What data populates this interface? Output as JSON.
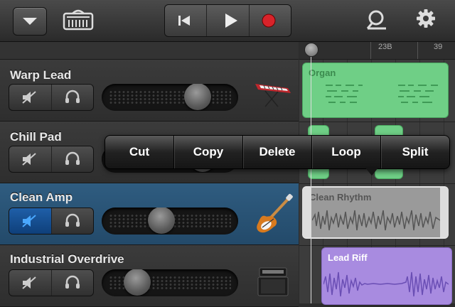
{
  "toolbar": {
    "icons": [
      "chevron-down-icon",
      "amp-icon",
      "rewind-icon",
      "play-icon",
      "record-icon",
      "loop-settings-icon",
      "gear-icon"
    ],
    "colors": {
      "record": "#d8232a"
    }
  },
  "tracks": [
    {
      "name": "Warp Lead",
      "instrument": "keyboard-synth-icon",
      "volume": 0.75,
      "muted": false
    },
    {
      "name": "Chill Pad",
      "instrument": "",
      "volume": 0.8,
      "muted": false
    },
    {
      "name": "Clean Amp",
      "instrument": "electric-guitar-icon",
      "volume": 0.42,
      "muted": true,
      "selected": true
    },
    {
      "name": "Industrial Overdrive",
      "instrument": "amplifier-stack-icon",
      "volume": 0.2,
      "muted": false
    }
  ],
  "ruler": {
    "labels": [
      "23B",
      "39"
    ]
  },
  "regions": {
    "organ": {
      "label": "Organ",
      "color": "#6fcf86"
    },
    "clean_rhythm": {
      "label": "Clean Rhythm",
      "color": "#9a9a9a"
    },
    "lead_riff": {
      "label": "Lead Riff",
      "color": "#a88be0"
    }
  },
  "context_menu": {
    "items": [
      "Cut",
      "Copy",
      "Delete",
      "Loop",
      "Split"
    ]
  }
}
